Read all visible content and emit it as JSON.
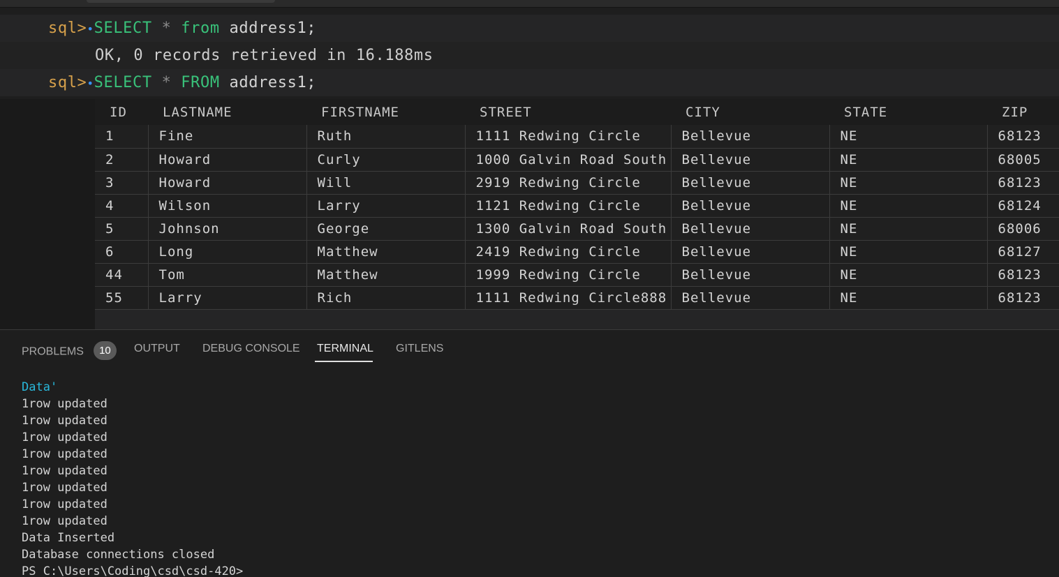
{
  "editor": {
    "cells": [
      {
        "prompt": "sql>",
        "dot": "•",
        "keyword1": "SELECT",
        "star": "*",
        "keyword2": "from",
        "table": "address1",
        "semi": ";",
        "output": "OK, 0 records retrieved in 16.188ms"
      },
      {
        "prompt": "sql>",
        "dot": "•",
        "keyword1": "SELECT",
        "star": "*",
        "keyword2": "FROM",
        "table": "address1",
        "semi": ";"
      }
    ]
  },
  "results": {
    "columns": [
      "ID",
      "LASTNAME",
      "FIRSTNAME",
      "STREET",
      "CITY",
      "STATE",
      "ZIP"
    ],
    "rows": [
      [
        "1",
        "Fine",
        "Ruth",
        "1111 Redwing Circle",
        "Bellevue",
        "NE",
        "68123"
      ],
      [
        "2",
        "Howard",
        "Curly",
        "1000 Galvin Road South",
        "Bellevue",
        "NE",
        "68005"
      ],
      [
        "3",
        "Howard",
        "Will",
        "2919 Redwing Circle",
        "Bellevue",
        "NE",
        "68123"
      ],
      [
        "4",
        "Wilson",
        "Larry",
        "1121 Redwing Circle",
        "Bellevue",
        "NE",
        "68124"
      ],
      [
        "5",
        "Johnson",
        "George",
        "1300 Galvin Road South",
        "Bellevue",
        "NE",
        "68006"
      ],
      [
        "6",
        "Long",
        "Matthew",
        "2419 Redwing Circle",
        "Bellevue",
        "NE",
        "68127"
      ],
      [
        "44",
        "Tom",
        "Matthew",
        "1999 Redwing Circle",
        "Bellevue",
        "NE",
        "68123"
      ],
      [
        "55",
        "Larry",
        "Rich",
        "1111 Redwing Circle888",
        "Bellevue",
        "NE",
        "68123"
      ]
    ]
  },
  "panel": {
    "tabs": {
      "problems": "PROBLEMS",
      "problems_count": "10",
      "output": "OUTPUT",
      "debug_console": "DEBUG CONSOLE",
      "terminal": "TERMINAL",
      "gitlens": "GITLENS"
    },
    "active_tab": "TERMINAL",
    "terminal_lines": [
      "Data'",
      "1row updated",
      "1row updated",
      "1row updated",
      "1row updated",
      "1row updated",
      "1row updated",
      "1row updated",
      "1row updated",
      "Data Inserted",
      "Database connections closed",
      "PS C:\\Users\\Coding\\csd\\csd-420>"
    ]
  },
  "colors": {
    "prompt": "#d7a14b",
    "keyword": "#39c27a",
    "terminal_accent": "#29b8db",
    "background": "#1e1e1e"
  }
}
